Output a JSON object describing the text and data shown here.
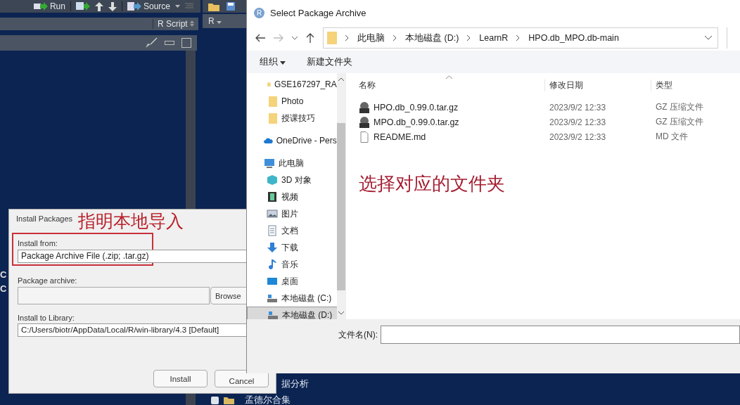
{
  "rstudio": {
    "toolbar": {
      "run_button": "Run",
      "source_button": "Source"
    },
    "file_type": "R Script",
    "language_selector": "R",
    "console_lines": [
      "C",
      "C"
    ],
    "files_pane": [
      {
        "name": "据分析"
      },
      {
        "name": "孟德尔合集",
        "checked": false
      }
    ]
  },
  "install_dialog": {
    "title": "Install Packages",
    "annotation": "指明本地导入",
    "install_from_label": "Install from:",
    "install_from_value": "Package Archive File (.zip; .tar.gz)",
    "archive_label": "Package archive:",
    "browse_button": "Browse",
    "library_label": "Install to Library:",
    "library_value": "C:/Users/biotr/AppData/Local/R/win-library/4.3 [Default]",
    "buttons": [
      "Install",
      "Cancel"
    ]
  },
  "file_dialog": {
    "app_icon": "R",
    "title": "Select Package Archive",
    "breadcrumbs": [
      "此电脑",
      "本地磁盘 (D:)",
      "LearnR",
      "HPO.db_MPO.db-main"
    ],
    "organize_menu": "组织",
    "new_folder_button": "新建文件夹",
    "nav_items": [
      {
        "label": "GSE167297_RA",
        "kind": "folder",
        "selected": false
      },
      {
        "label": "Photo",
        "kind": "folder",
        "selected": false
      },
      {
        "label": "授课技巧",
        "kind": "folder",
        "selected": false
      },
      {
        "label": "OneDrive - Pers",
        "kind": "cloud",
        "selected": false
      },
      {
        "label": "此电脑",
        "kind": "computer",
        "selected": false,
        "children": [
          {
            "label": "3D 对象",
            "kind": "cube",
            "selected": false
          },
          {
            "label": "视频",
            "kind": "film",
            "selected": false
          },
          {
            "label": "图片",
            "kind": "picture",
            "selected": false
          },
          {
            "label": "文档",
            "kind": "document",
            "selected": false
          },
          {
            "label": "下载",
            "kind": "download",
            "selected": false
          },
          {
            "label": "音乐",
            "kind": "music",
            "selected": false
          },
          {
            "label": "桌面",
            "kind": "desktop",
            "selected": false
          },
          {
            "label": "本地磁盘 (C:)",
            "kind": "drive",
            "selected": false
          },
          {
            "label": "本地磁盘 (D:)",
            "kind": "drive",
            "selected": true
          }
        ]
      }
    ],
    "columns": [
      "名称",
      "修改日期",
      "类型"
    ],
    "files": [
      {
        "name": "HPO.db_0.99.0.tar.gz",
        "modified": "2023/9/2 12:33",
        "type": "GZ 压缩文件",
        "kind": "gz"
      },
      {
        "name": "MPO.db_0.99.0.tar.gz",
        "modified": "2023/9/2 12:33",
        "type": "GZ 压缩文件",
        "kind": "gz"
      },
      {
        "name": "README.md",
        "modified": "2023/9/2 12:33",
        "type": "MD 文件",
        "kind": "md"
      }
    ],
    "annotation": "选择对应的文件夹",
    "filename_label": "文件名(N):"
  }
}
